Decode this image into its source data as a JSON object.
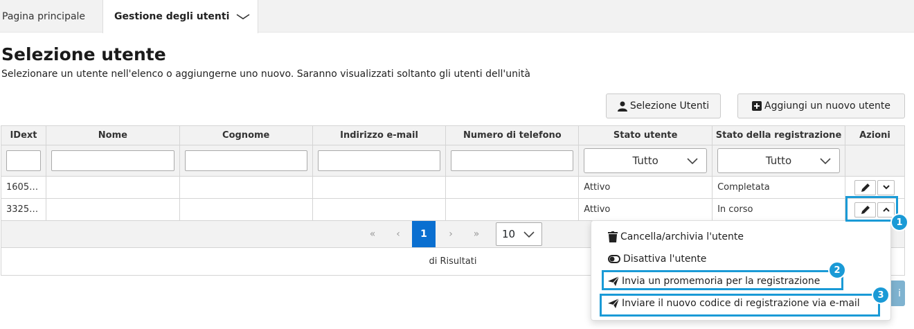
{
  "nav": {
    "home": "Pagina principale",
    "users": "Gestione degli utenti"
  },
  "page": {
    "title": "Selezione utente",
    "subtitle": "Selezionare un utente nell'elenco o aggiungerne uno nuovo. Saranno visualizzati soltanto gli utenti dell'unità"
  },
  "buttons": {
    "select_users": "Selezione Utenti",
    "add_user": "Aggiungi un nuovo utente"
  },
  "table": {
    "headers": [
      "IDext",
      "Nome",
      "Cognome",
      "Indirizzo e-mail",
      "Numero di telefono",
      "Stato utente",
      "Stato della registrazione",
      "Azioni"
    ],
    "filters": {
      "user_status": "Tutto",
      "registration_status": "Tutto"
    },
    "rows": [
      {
        "idext": "1605…",
        "user_status": "Attivo",
        "registration_status": "Completata"
      },
      {
        "idext": "3325…",
        "user_status": "Attivo",
        "registration_status": "In corso"
      }
    ]
  },
  "pager": {
    "current_page": "1",
    "page_size": "10",
    "first": "«",
    "prev": "‹",
    "next": "›",
    "last": "»"
  },
  "footer": {
    "results_text": "di Risultati"
  },
  "menu": {
    "items": [
      "Cancella/archivia l'utente",
      "Disattiva l'utente",
      "Invia un promemoria per la registrazione",
      "Inviare il nuovo codice di registrazione via e-mail"
    ]
  },
  "badges": [
    "1",
    "2",
    "3"
  ],
  "partial_button_text": "i",
  "colors": {
    "accent": "#1a9ad6",
    "active_page": "#0a6fd0"
  }
}
